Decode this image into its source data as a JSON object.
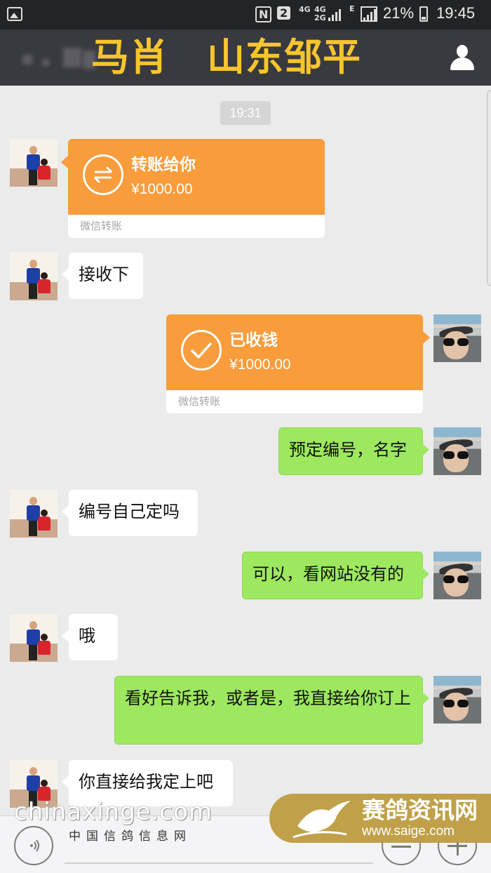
{
  "status_bar": {
    "nfc": "N",
    "sim_slot": "2",
    "net1_top": "4G",
    "net1_bottom": "",
    "net2_top": "4G",
    "net2_bottom": "2G",
    "e_indicator": "E",
    "battery": "21%",
    "time": "19:45"
  },
  "header": {
    "title": "马肖　山东邹平"
  },
  "chat": {
    "timestamp": "19:31",
    "transfer_received": {
      "title": "转账给你",
      "amount": "¥1000.00",
      "footer": "微信转账"
    },
    "msg1": "接收下",
    "transfer_accepted": {
      "title": "已收钱",
      "amount": "¥1000.00",
      "footer": "微信转账"
    },
    "msg2": "预定编号，名字",
    "msg3": "编号自己定吗",
    "msg4": "可以，看网站没有的",
    "msg5": "哦",
    "msg6": "看好告诉我，或者是，我直接给你订上",
    "msg7": "你直接给我定上吧"
  },
  "watermark": {
    "left_brand": "chinaxinge.com",
    "left_sub": "中国信鸽信息网",
    "right_brand": "赛鸽资讯网",
    "right_url": "www.saige.com"
  },
  "colors": {
    "title_yellow": "#f7c52c",
    "transfer_orange": "#f89c3c",
    "my_bubble_green": "#9de85f",
    "header_bg": "#393a3f"
  },
  "icons": [
    "gallery-icon",
    "nfc-icon",
    "signal-icon",
    "battery-icon",
    "contact-icon",
    "transfer-arrows-icon",
    "check-icon",
    "voice-icon",
    "emoji-icon",
    "plus-icon"
  ]
}
